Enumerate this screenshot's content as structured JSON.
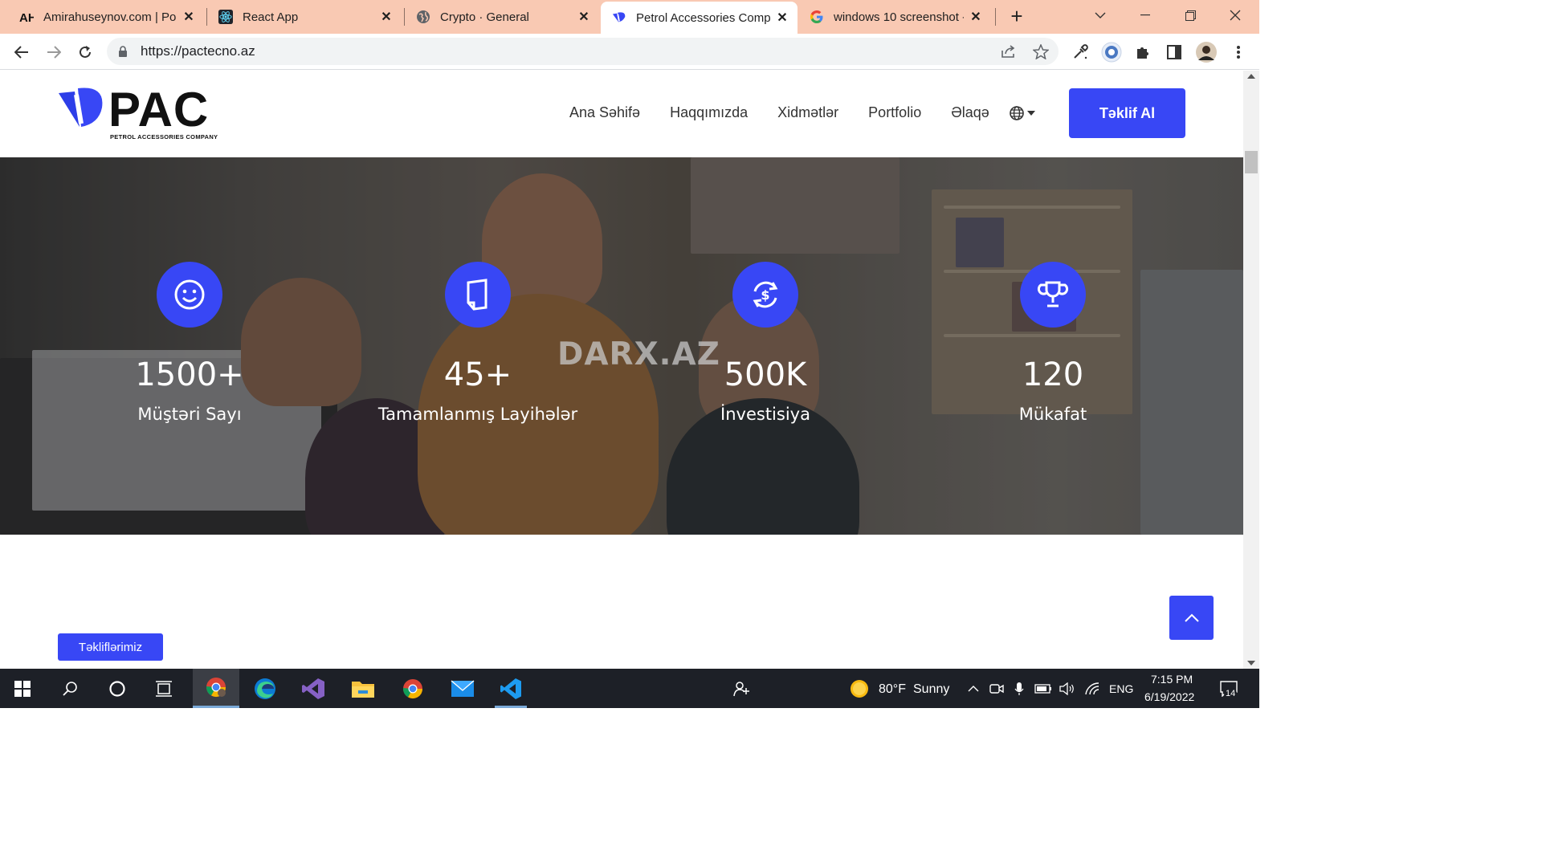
{
  "browser": {
    "tabs": [
      {
        "title": "Amirahuseynov.com | Port",
        "favicon": "ah-logo-icon",
        "active": false
      },
      {
        "title": "React App",
        "favicon": "react-icon",
        "active": false
      },
      {
        "title": "Crypto · General",
        "favicon": "globe-icon",
        "active": false
      },
      {
        "title": "Petrol Accessories Compa",
        "favicon": "pac-logo-icon",
        "active": true
      },
      {
        "title": "windows 10 screenshot -",
        "favicon": "google-icon",
        "active": false
      }
    ],
    "url": "https://pactecno.az"
  },
  "site": {
    "logo_text": "PAC",
    "logo_subtitle": "PETROL ACCESSORIES COMPANY",
    "nav": [
      "Ana Səhifə",
      "Haqqımızda",
      "Xidmətlər",
      "Portfolio",
      "Əlaqə"
    ],
    "cta_label": "Təklif Al",
    "watermark": "DARX.AZ",
    "stats": [
      {
        "value": "1500+",
        "label": "Müştəri Sayı",
        "icon": "smiley-icon"
      },
      {
        "value": "45+",
        "label": "Tamamlanmış Layihələr",
        "icon": "document-icon"
      },
      {
        "value": "500K",
        "label": "İnvestisiya",
        "icon": "dollar-exchange-icon"
      },
      {
        "value": "120",
        "label": "Mükafat",
        "icon": "trophy-icon"
      }
    ],
    "offers_label": "Təkliflərimiz",
    "accent_color": "#3847f5"
  },
  "taskbar": {
    "weather_temp": "80°F",
    "weather_text": "Sunny",
    "language": "ENG",
    "time": "7:15 PM",
    "date": "6/19/2022",
    "notification_count": "14"
  }
}
